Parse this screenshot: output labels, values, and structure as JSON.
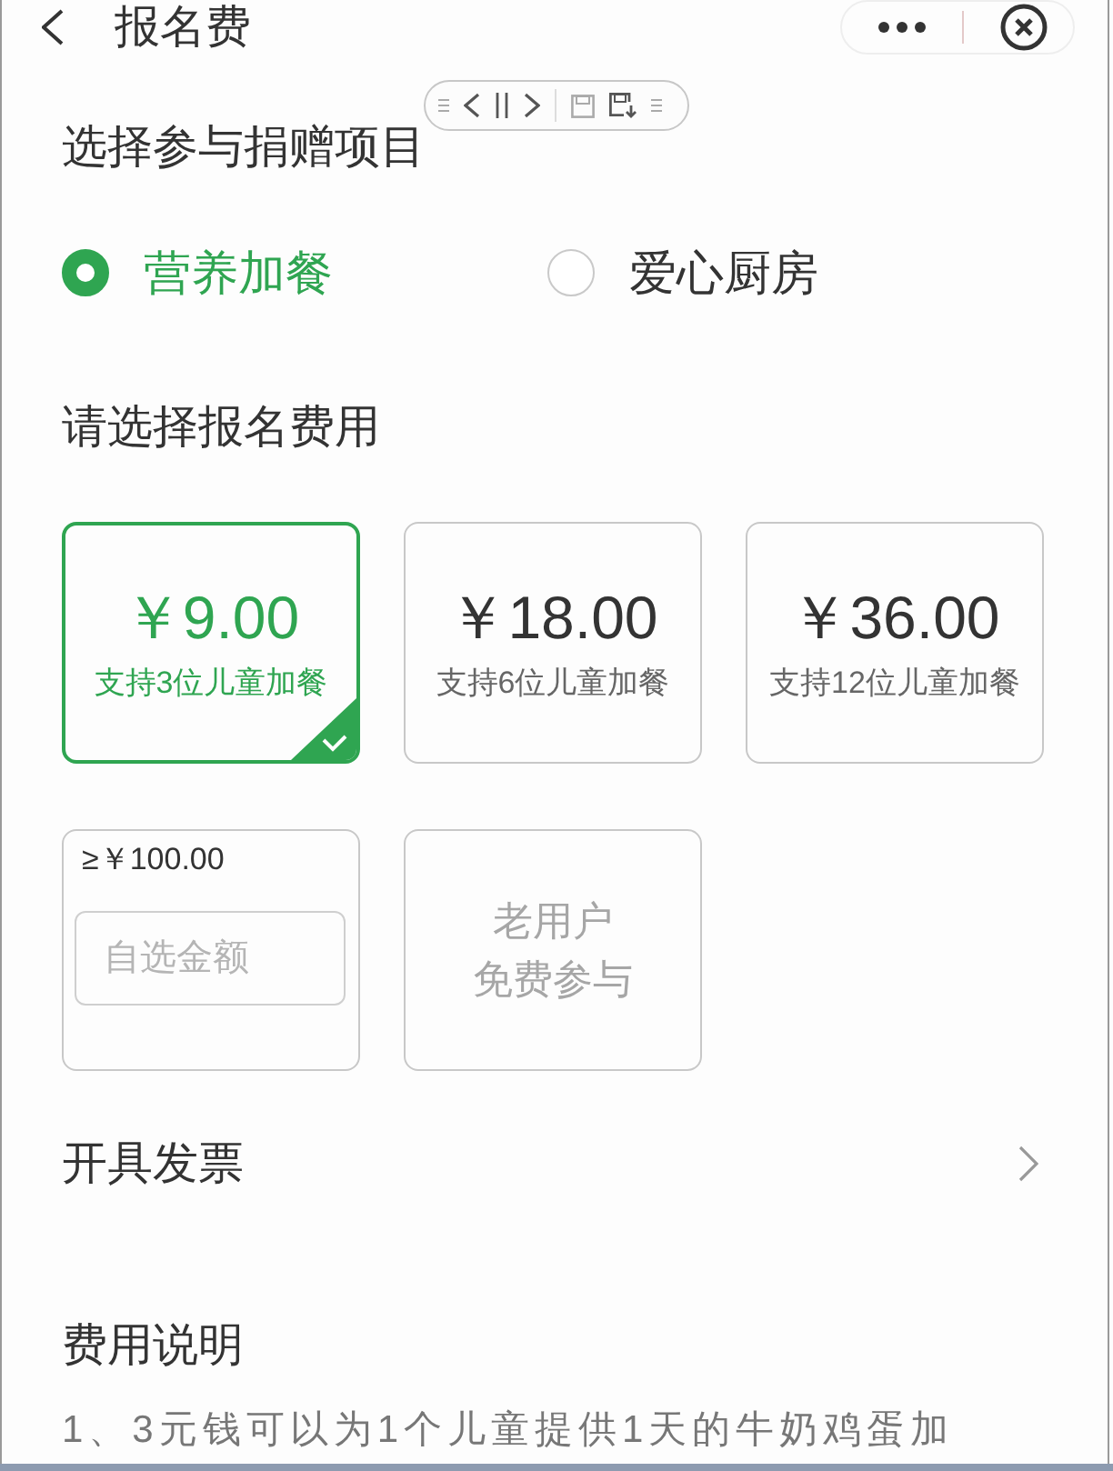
{
  "header": {
    "title": "报名费"
  },
  "project_section": {
    "heading": "选择参与捐赠项目",
    "options": [
      {
        "label": "营养加餐",
        "selected": true
      },
      {
        "label": "爱心厨房",
        "selected": false
      }
    ]
  },
  "fee_section": {
    "heading": "请选择报名费用",
    "options": [
      {
        "kind": "preset",
        "price": "￥9.00",
        "description": "支持3位儿童加餐",
        "selected": true
      },
      {
        "kind": "preset",
        "price": "￥18.00",
        "description": "支持6位儿童加餐",
        "selected": false
      },
      {
        "kind": "preset",
        "price": "￥36.00",
        "description": "支持12位儿童加餐",
        "selected": false
      },
      {
        "kind": "custom",
        "minimum": "≥￥100.00",
        "placeholder": "自选金额",
        "selected": false
      },
      {
        "kind": "free",
        "label_lines": [
          "老用户",
          "免费参与"
        ],
        "selected": false,
        "disabled": true
      }
    ]
  },
  "invoice": {
    "label": "开具发票"
  },
  "fee_notes": {
    "heading": "费用说明",
    "lines": [
      "1、3元钱可以为1个儿童提供1天的牛奶鸡蛋加"
    ]
  }
}
